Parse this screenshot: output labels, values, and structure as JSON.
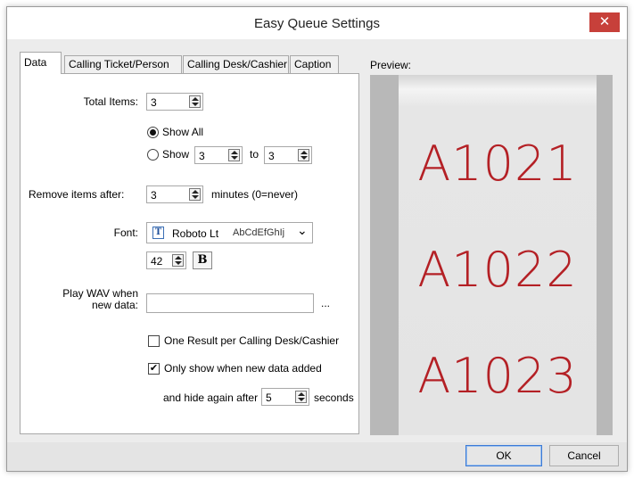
{
  "window": {
    "title": "Easy Queue Settings",
    "close_glyph": "✕"
  },
  "tabs": [
    {
      "label": "Data",
      "active": true
    },
    {
      "label": "Calling Ticket/Person",
      "active": false
    },
    {
      "label": "Calling Desk/Cashier",
      "active": false
    },
    {
      "label": "Caption",
      "active": false
    }
  ],
  "data_tab": {
    "total_items_label": "Total Items:",
    "total_items_value": "3",
    "show_all_label": "Show All",
    "show_label": "Show",
    "show_from_value": "3",
    "to_label": "to",
    "show_to_value": "3",
    "remove_label": "Remove items after:",
    "remove_value": "3",
    "remove_unit": "minutes (0=never)",
    "font_label": "Font:",
    "font_icon_glyph": "T",
    "font_name": "Roboto Lt",
    "font_sample": "AbCdEfGhIj",
    "dropdown_glyph": "⌄",
    "font_size_value": "42",
    "bold_glyph": "B",
    "wav_label_line1": "Play WAV when",
    "wav_label_line2": "new data:",
    "wav_value": "",
    "browse_label": "...",
    "one_result_label": "One Result per Calling Desk/Cashier",
    "one_result_checked": false,
    "only_show_label": "Only show when new data added",
    "only_show_checked": true,
    "check_glyph": "✔",
    "hide_label": "and hide again after",
    "hide_value": "5",
    "hide_unit": "seconds"
  },
  "preview": {
    "label": "Preview:",
    "tickets": [
      "A1021",
      "A1022",
      "A1023"
    ],
    "ticket_color": "#b42025"
  },
  "buttons": {
    "ok": "OK",
    "cancel": "Cancel"
  },
  "colors": {
    "close_button": "#c7403a",
    "default_button_border": "#3d7bd6"
  }
}
